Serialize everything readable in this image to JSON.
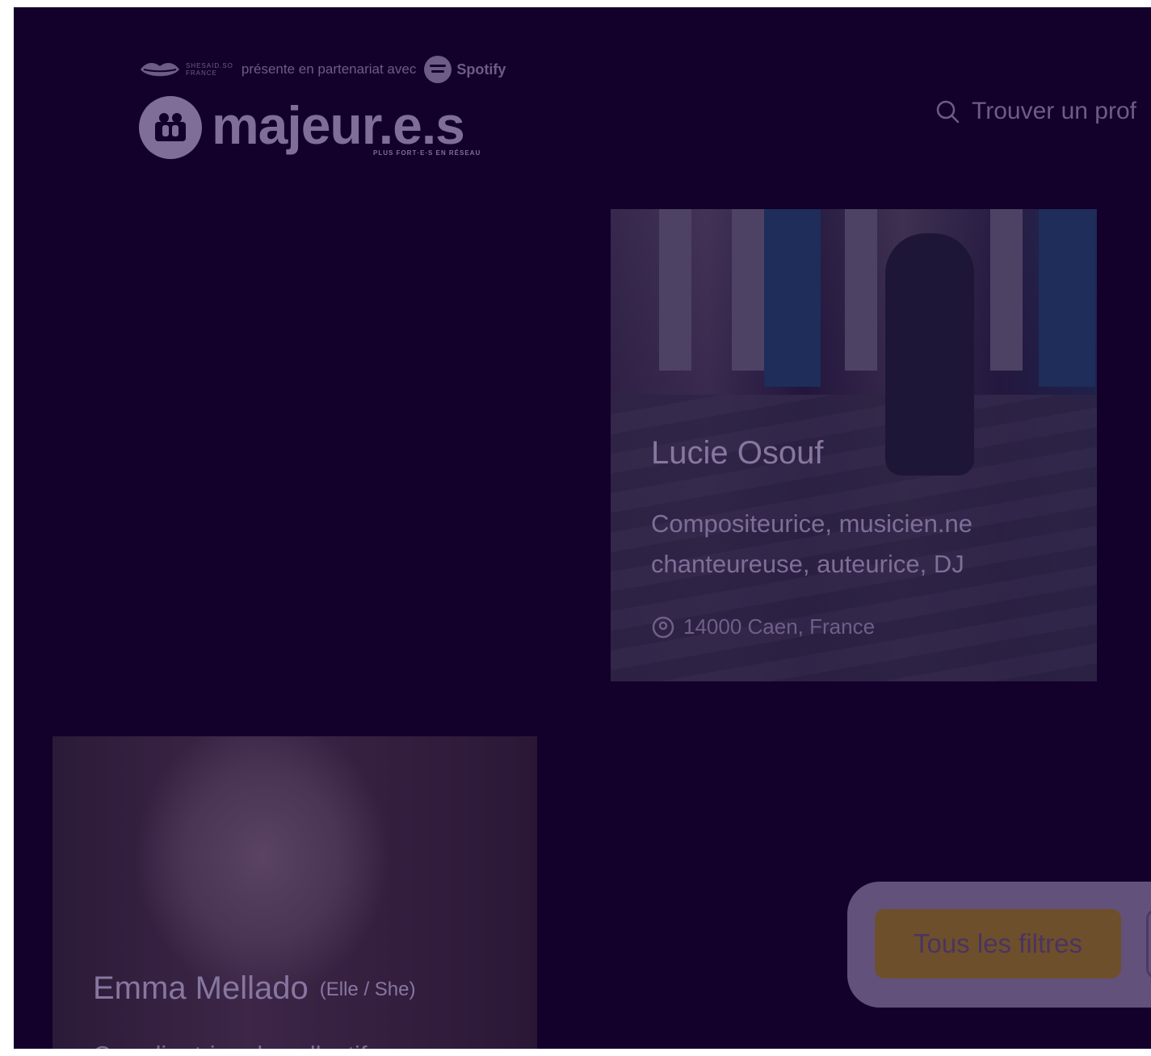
{
  "header": {
    "partner_org_line1": "SHESAID.SO",
    "partner_org_line2": "FRANCE",
    "partnership_text": "présente en partenariat avec",
    "spotify_label": "Spotify",
    "brand_name": "majeur.e.s",
    "brand_tagline": "PLUS FORT·E·S EN RÉSEAU",
    "search_label": "Trouver un prof"
  },
  "profiles": [
    {
      "name": "Lucie Osouf",
      "role_line1": "Compositeurice, musicien.ne",
      "role_line2": "chanteureuse, auteurice, DJ",
      "location": "14000 Caen, France"
    },
    {
      "name": "Emma Mellado",
      "pronouns": "(Elle / She)",
      "role_line1": "Coordinatrice du collectif"
    }
  ],
  "filters": {
    "all_filters_label": "Tous les filtres"
  },
  "colors": {
    "background": "#13002b",
    "overlay_text": "#7a6a92",
    "filter_button": "#6e4f2c"
  }
}
